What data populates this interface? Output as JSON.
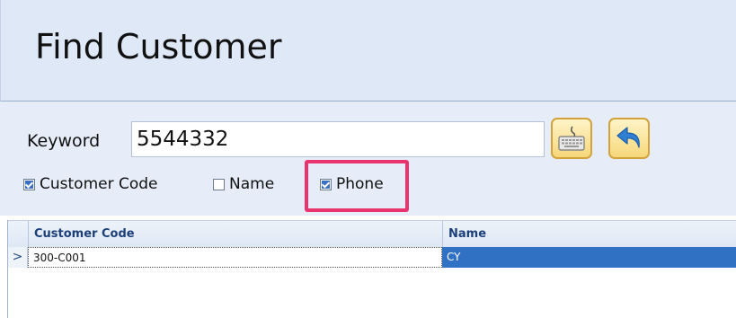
{
  "header": {
    "title": "Find Customer"
  },
  "search": {
    "keyword_label": "Keyword",
    "keyword_value": "5544332",
    "keyboard_button_icon": "keyboard-icon",
    "back_button_icon": "back-arrow-icon"
  },
  "filters": [
    {
      "label": "Customer Code",
      "checked": true
    },
    {
      "label": "Name",
      "checked": false
    },
    {
      "label": "Phone",
      "checked": true
    }
  ],
  "grid": {
    "columns": [
      "Customer Code",
      "Name"
    ],
    "rows": [
      {
        "indicator": ">",
        "code": "300-C001",
        "name": "CY",
        "selected": true
      }
    ]
  },
  "colors": {
    "header_bg": "#dfe8f6",
    "highlight_border": "#e8336e",
    "selected_row": "#3071c4",
    "button_border": "#d2a33a"
  }
}
